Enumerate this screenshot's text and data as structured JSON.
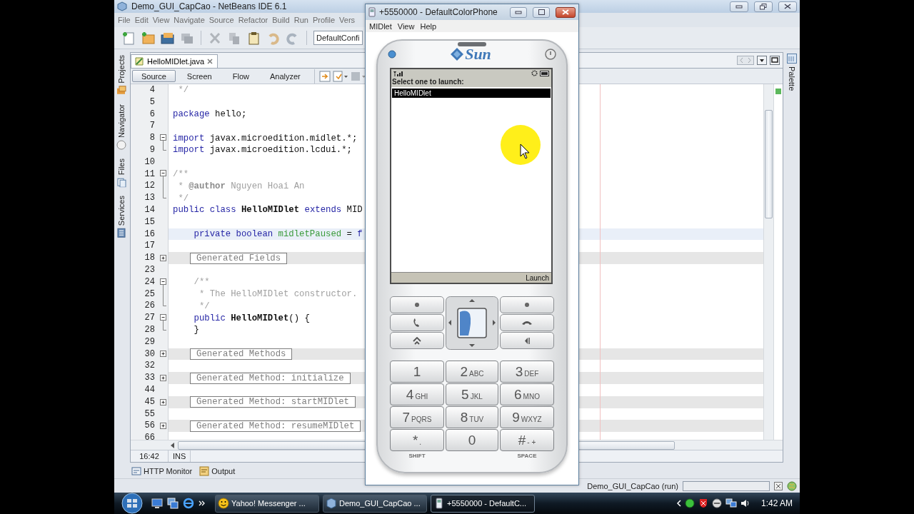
{
  "ide": {
    "title": "Demo_GUI_CapCao - NetBeans IDE 6.1",
    "menu": [
      "File",
      "Edit",
      "View",
      "Navigate",
      "Source",
      "Refactor",
      "Build",
      "Run",
      "Profile",
      "Vers"
    ],
    "config": "DefaultConfi",
    "side_tabs": [
      "Projects",
      "Navigator",
      "Files",
      "Services"
    ],
    "right_tabs": [
      "Palette"
    ],
    "file_tab": {
      "label": "HelloMIDlet.java",
      "selected": true
    },
    "views": [
      {
        "label": "Source",
        "selected": true
      },
      {
        "label": "Screen",
        "selected": false
      },
      {
        "label": "Flow",
        "selected": false
      },
      {
        "label": "Analyzer",
        "selected": false
      }
    ],
    "code": [
      {
        "number": "4",
        "kind": "code",
        "segments": [
          {
            "kind": "comment",
            "text": " */"
          }
        ]
      },
      {
        "number": "5",
        "kind": "code"
      },
      {
        "number": "6",
        "kind": "code",
        "segments": [
          {
            "kind": "keyword",
            "text": "package"
          },
          {
            "kind": "plain",
            "text": " hello;"
          }
        ]
      },
      {
        "number": "7",
        "kind": "code"
      },
      {
        "number": "8",
        "kind": "code",
        "gutter": {
          "kind": "open"
        },
        "segments": [
          {
            "kind": "keyword",
            "text": "import"
          },
          {
            "kind": "plain",
            "text": " javax.microedition.midlet.*;"
          }
        ]
      },
      {
        "number": "9",
        "kind": "code",
        "gutter": {
          "kind": "end"
        },
        "segments": [
          {
            "kind": "keyword",
            "text": "import"
          },
          {
            "kind": "plain",
            "text": " javax.microedition.lcdui.*;"
          }
        ]
      },
      {
        "number": "10",
        "kind": "code"
      },
      {
        "number": "11",
        "kind": "code",
        "gutter": {
          "kind": "open"
        },
        "segments": [
          {
            "kind": "comment",
            "text": "/**"
          }
        ]
      },
      {
        "number": "12",
        "kind": "code",
        "gutter": {
          "kind": "line"
        },
        "segments": [
          {
            "kind": "comment",
            "text": " *"
          },
          {
            "kind": "tag",
            "text": " @author"
          },
          {
            "kind": "comment",
            "text": " Nguyen Hoai An"
          }
        ]
      },
      {
        "number": "13",
        "kind": "code",
        "gutter": {
          "kind": "end"
        },
        "segments": [
          {
            "kind": "comment",
            "text": " */"
          }
        ]
      },
      {
        "number": "14",
        "kind": "code",
        "segments": [
          {
            "kind": "keyword",
            "text": "public class"
          },
          {
            "kind": "bold",
            "text": " HelloMIDlet"
          },
          {
            "kind": "keyword",
            "text": " extends"
          },
          {
            "kind": "plain",
            "text": " MID"
          }
        ]
      },
      {
        "number": "15",
        "kind": "code"
      },
      {
        "number": "16",
        "kind": "code",
        "current": true,
        "segments": [
          {
            "kind": "keyword",
            "text": "    private boolean"
          },
          {
            "kind": "field",
            "text": " midletPaused"
          },
          {
            "kind": "plain",
            "text": " = "
          },
          {
            "kind": "keyword",
            "text": "f"
          }
        ]
      },
      {
        "number": "17",
        "kind": "code"
      },
      {
        "number": "18",
        "kind": "fold",
        "gutter": {
          "kind": "closed"
        },
        "label": "Generated Fields"
      },
      {
        "number": "23",
        "kind": "code"
      },
      {
        "number": "24",
        "kind": "code",
        "gutter": {
          "kind": "open"
        },
        "segments": [
          {
            "kind": "comment",
            "text": "    /**"
          }
        ]
      },
      {
        "number": "25",
        "kind": "code",
        "gutter": {
          "kind": "line"
        },
        "segments": [
          {
            "kind": "comment",
            "text": "     * The HelloMIDlet constructor."
          }
        ]
      },
      {
        "number": "26",
        "kind": "code",
        "gutter": {
          "kind": "end"
        },
        "segments": [
          {
            "kind": "comment",
            "text": "     */"
          }
        ]
      },
      {
        "number": "27",
        "kind": "code",
        "gutter": {
          "kind": "open"
        },
        "segments": [
          {
            "kind": "keyword",
            "text": "    public"
          },
          {
            "kind": "bold",
            "text": " HelloMIDlet"
          },
          {
            "kind": "plain",
            "text": "() {"
          }
        ]
      },
      {
        "number": "28",
        "kind": "code",
        "gutter": {
          "kind": "end"
        },
        "segments": [
          {
            "kind": "plain",
            "text": "    }"
          }
        ]
      },
      {
        "number": "29",
        "kind": "code"
      },
      {
        "number": "30",
        "kind": "fold",
        "gutter": {
          "kind": "closed"
        },
        "label": "Generated Methods"
      },
      {
        "number": "32",
        "kind": "code"
      },
      {
        "number": "33",
        "kind": "fold",
        "gutter": {
          "kind": "closed"
        },
        "label": "Generated Method: initialize"
      },
      {
        "number": "44",
        "kind": "code"
      },
      {
        "number": "45",
        "kind": "fold",
        "gutter": {
          "kind": "closed"
        },
        "label": "Generated Method: startMIDlet"
      },
      {
        "number": "55",
        "kind": "code"
      },
      {
        "number": "56",
        "kind": "fold",
        "gutter": {
          "kind": "closed"
        },
        "label": "Generated Method: resumeMIDlet"
      },
      {
        "number": "66",
        "kind": "code"
      }
    ],
    "position": "16:42",
    "mode": "INS",
    "bottom_tabs": [
      "HTTP Monitor",
      "Output"
    ],
    "task": "Demo_GUI_CapCao (run)"
  },
  "phone": {
    "title": "+5550000 - DefaultColorPhone",
    "menu": [
      "MIDlet",
      "View",
      "Help"
    ],
    "logo": "Sun",
    "heading": "Select one to launch:",
    "apps": [
      {
        "label": "HelloMIDlet",
        "selected": true
      }
    ],
    "softkey": "Launch",
    "keys": [
      {
        "digit": "1"
      },
      {
        "digit": "2",
        "letters": "ABC"
      },
      {
        "digit": "3",
        "letters": "DEF"
      },
      {
        "digit": "4",
        "letters": "GHI"
      },
      {
        "digit": "5",
        "letters": "JKL"
      },
      {
        "digit": "6",
        "letters": "MNO"
      },
      {
        "digit": "7",
        "letters": "PQRS"
      },
      {
        "digit": "8",
        "letters": "TUV"
      },
      {
        "digit": "9",
        "letters": "WXYZ"
      },
      {
        "digit": "*",
        "letters": "."
      },
      {
        "digit": "0"
      },
      {
        "digit": "#",
        "letters": "- +"
      }
    ],
    "key_labels": [
      "SHIFT",
      "SPACE"
    ]
  },
  "taskbar": {
    "windows": [
      {
        "kind": "messenger",
        "label": "Yahoo! Messenger ...",
        "selected": false
      },
      {
        "kind": "ide",
        "label": "Demo_GUI_CapCao ...",
        "selected": false
      },
      {
        "kind": "phone",
        "label": "+5550000 - DefaultC...",
        "selected": true
      }
    ],
    "clock": "1:42 AM"
  }
}
